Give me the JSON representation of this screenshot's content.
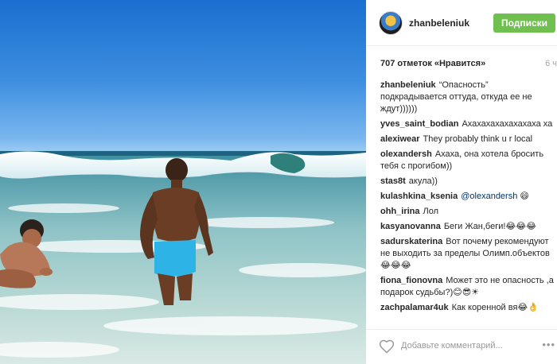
{
  "post": {
    "username": "zhanbeleniuk",
    "follow_label": "Подписки",
    "likes": "707 отметок «Нравится»",
    "time": "6 ч"
  },
  "comments": [
    {
      "user": "zhanbeleniuk",
      "text": "“Опасность” подкрадывается оттуда, откуда ее не ждут))))))"
    },
    {
      "user": "yves_saint_bodian",
      "text": "Ахахахахахахахаха ха"
    },
    {
      "user": "alexiwear",
      "text": "They probably think u r local"
    },
    {
      "user": "olexandersh",
      "text": "Ахаха, она хотела бросить тебя с прогибом))"
    },
    {
      "user": "stas8t",
      "text": "акула))"
    },
    {
      "user": "kulashkina_ksenia",
      "mention": "@olexandersh",
      "text": "😄"
    },
    {
      "user": "ohh_irina",
      "text": "Лол"
    },
    {
      "user": "kasyanovanna",
      "text": "Беги Жан,беги!😂😂😂"
    },
    {
      "user": "sadurskaterina",
      "text": "Вот почему рекомендуют не выходить за пределы Олимп.объектов😂😂😂"
    },
    {
      "user": "fiona_fionovna",
      "text": "Может это не опасность ,а подарок судьбы?)😊😎☀"
    },
    {
      "user": "zachpalamar4uk",
      "text": "Как коренной вя😂👌"
    }
  ],
  "footer": {
    "placeholder": "Добавьте комментарий...",
    "more": "•••"
  }
}
